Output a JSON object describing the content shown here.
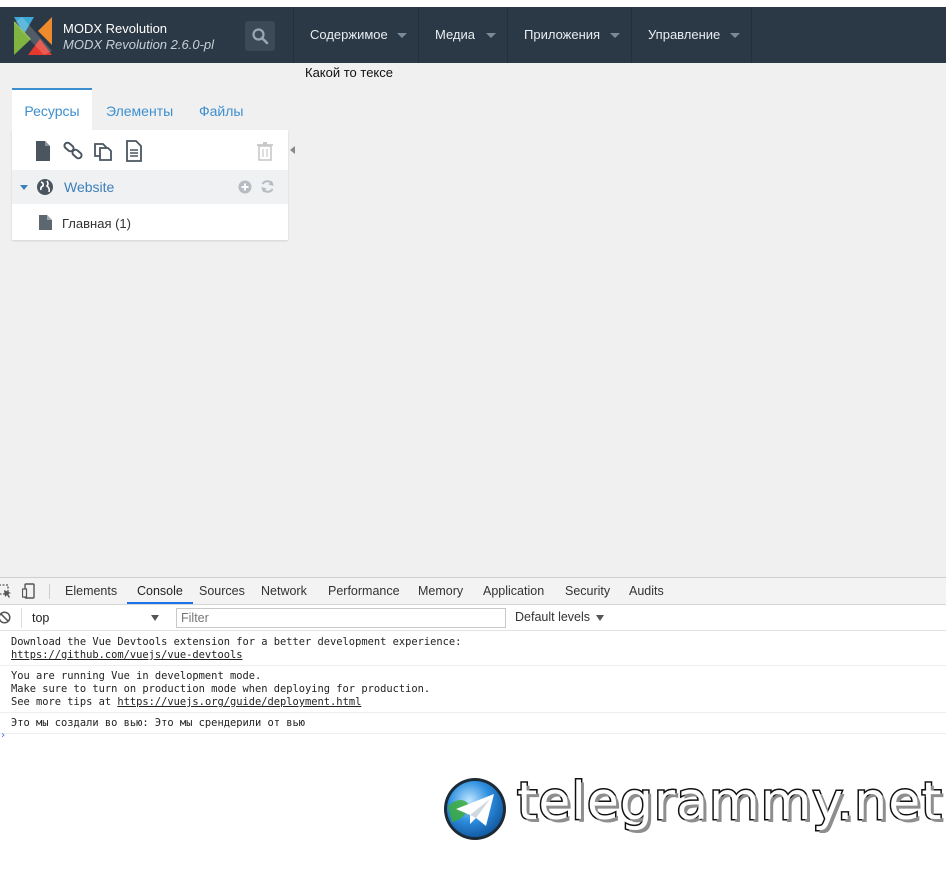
{
  "header": {
    "brand_title": "MODX Revolution",
    "brand_version": "MODX Revolution 2.6.0-pl",
    "nav": [
      {
        "label": "Содержимое"
      },
      {
        "label": "Медиа"
      },
      {
        "label": "Приложения"
      },
      {
        "label": "Управление"
      }
    ]
  },
  "page_text": "Какой то тексе",
  "tree": {
    "tabs": [
      {
        "label": "Ресурсы",
        "active": true
      },
      {
        "label": "Элементы"
      },
      {
        "label": "Файлы"
      }
    ],
    "toolbar_icons": [
      "new-document-icon",
      "weblink-icon",
      "symlink-icon",
      "static-resource-icon",
      "trash-icon"
    ],
    "root_label": "Website",
    "child_label": "Главная (1)"
  },
  "devtools": {
    "tabs": [
      "Elements",
      "Console",
      "Sources",
      "Network",
      "Performance",
      "Memory",
      "Application",
      "Security",
      "Audits"
    ],
    "active_tab": "Console",
    "context": "top",
    "filter_placeholder": "Filter",
    "levels": "Default levels",
    "messages": [
      {
        "line1": "Download the Vue Devtools extension for a better development experience:",
        "link": "https://github.com/vuejs/vue-devtools"
      },
      {
        "line1": "You are running Vue in development mode.",
        "line2": "Make sure to turn on production mode when deploying for production.",
        "line3_prefix": "See more tips at ",
        "link": "https://vuejs.org/guide/deployment.html"
      },
      {
        "line1": "Это мы создали во вью: Это мы срендерили от вью"
      }
    ],
    "prompt": "›"
  },
  "watermark": {
    "text": "telegrammy.net"
  },
  "colors": {
    "header_bg": "#2b3946",
    "accent": "#3d8fcf",
    "panel_bg": "#f0f0f0"
  }
}
